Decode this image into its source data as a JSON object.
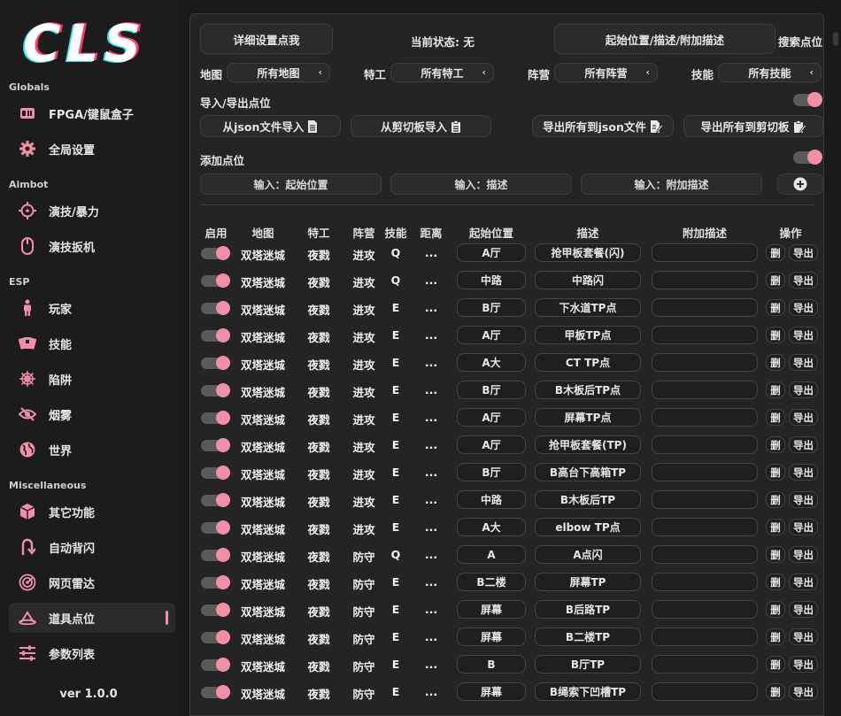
{
  "app": {
    "logo_text": "CLS",
    "version": "ver 1.0.0",
    "accent": "#f08fa5"
  },
  "sidebar": {
    "sections": [
      {
        "title": "Globals",
        "items": [
          {
            "label": "FPGA/键鼠盒子",
            "icon": "fpga-card-icon"
          },
          {
            "label": "全局设置",
            "icon": "gear-icon"
          }
        ]
      },
      {
        "title": "Aimbot",
        "items": [
          {
            "label": "演技/暴力",
            "icon": "crosshair-icon"
          },
          {
            "label": "演技扳机",
            "icon": "mouse-icon"
          }
        ]
      },
      {
        "title": "ESP",
        "items": [
          {
            "label": "玩家",
            "icon": "person-icon"
          },
          {
            "label": "技能",
            "icon": "cards-icon"
          },
          {
            "label": "陷阱",
            "icon": "spiderweb-icon"
          },
          {
            "label": "烟雾",
            "icon": "eye-slash-icon"
          },
          {
            "label": "世界",
            "icon": "globe-icon"
          }
        ]
      },
      {
        "title": "Miscellaneous",
        "items": [
          {
            "label": "其它功能",
            "icon": "cube-icon"
          },
          {
            "label": "自动背闪",
            "icon": "u-turn-icon"
          },
          {
            "label": "网页雷达",
            "icon": "radar-icon"
          },
          {
            "label": "道具点位",
            "icon": "location-icon",
            "active": true
          },
          {
            "label": "参数列表",
            "icon": "sliders-icon"
          }
        ]
      }
    ]
  },
  "toolbar": {
    "detail_button": "详细设置点我",
    "status_text": "当前状态: 无",
    "search_field_value": "起始位置/描述/附加描述",
    "search_label": "搜索点位"
  },
  "filters": [
    {
      "label": "地图",
      "value": "所有地图"
    },
    {
      "label": "特工",
      "value": "所有特工"
    },
    {
      "label": "阵营",
      "value": "所有阵营"
    },
    {
      "label": "技能",
      "value": "所有技能"
    }
  ],
  "import_export": {
    "title": "导入/导出点位",
    "toggle_on": true,
    "import_json": "从json文件导入",
    "import_clipboard": "从剪切板导入",
    "export_json": "导出所有到json文件",
    "export_clipboard": "导出所有到剪切板"
  },
  "add_point": {
    "title": "添加点位",
    "toggle_on": true,
    "start_placeholder": "输入：起始位置",
    "desc_placeholder": "输入：描述",
    "extra_placeholder": "输入：附加描述"
  },
  "table": {
    "headers": [
      "启用",
      "地图",
      "特工",
      "阵营",
      "技能",
      "距离",
      "起始位置",
      "描述",
      "附加描述",
      "操作"
    ],
    "delete_label": "删",
    "export_label": "导出",
    "rows": [
      {
        "enabled": true,
        "map": "双塔迷城",
        "agent": "夜戮",
        "side": "进攻",
        "skill": "Q",
        "dist": "...",
        "start": "A厅",
        "desc": "抢甲板套餐(闪)",
        "extra": ""
      },
      {
        "enabled": true,
        "map": "双塔迷城",
        "agent": "夜戮",
        "side": "进攻",
        "skill": "Q",
        "dist": "...",
        "start": "中路",
        "desc": "中路闪",
        "extra": ""
      },
      {
        "enabled": true,
        "map": "双塔迷城",
        "agent": "夜戮",
        "side": "进攻",
        "skill": "E",
        "dist": "...",
        "start": "B厅",
        "desc": "下水道TP点",
        "extra": ""
      },
      {
        "enabled": true,
        "map": "双塔迷城",
        "agent": "夜戮",
        "side": "进攻",
        "skill": "E",
        "dist": "...",
        "start": "A厅",
        "desc": "甲板TP点",
        "extra": ""
      },
      {
        "enabled": true,
        "map": "双塔迷城",
        "agent": "夜戮",
        "side": "进攻",
        "skill": "E",
        "dist": "...",
        "start": "A大",
        "desc": "CT TP点",
        "extra": ""
      },
      {
        "enabled": true,
        "map": "双塔迷城",
        "agent": "夜戮",
        "side": "进攻",
        "skill": "E",
        "dist": "...",
        "start": "B厅",
        "desc": "B木板后TP点",
        "extra": ""
      },
      {
        "enabled": true,
        "map": "双塔迷城",
        "agent": "夜戮",
        "side": "进攻",
        "skill": "E",
        "dist": "...",
        "start": "A厅",
        "desc": "屏幕TP点",
        "extra": ""
      },
      {
        "enabled": true,
        "map": "双塔迷城",
        "agent": "夜戮",
        "side": "进攻",
        "skill": "E",
        "dist": "...",
        "start": "A厅",
        "desc": "抢甲板套餐(TP)",
        "extra": ""
      },
      {
        "enabled": true,
        "map": "双塔迷城",
        "agent": "夜戮",
        "side": "进攻",
        "skill": "E",
        "dist": "...",
        "start": "B厅",
        "desc": "B高台下高箱TP",
        "extra": ""
      },
      {
        "enabled": true,
        "map": "双塔迷城",
        "agent": "夜戮",
        "side": "进攻",
        "skill": "E",
        "dist": "...",
        "start": "中路",
        "desc": "B木板后TP",
        "extra": ""
      },
      {
        "enabled": true,
        "map": "双塔迷城",
        "agent": "夜戮",
        "side": "进攻",
        "skill": "E",
        "dist": "...",
        "start": "A大",
        "desc": "elbow TP点",
        "extra": ""
      },
      {
        "enabled": true,
        "map": "双塔迷城",
        "agent": "夜戮",
        "side": "防守",
        "skill": "Q",
        "dist": "...",
        "start": "A",
        "desc": "A点闪",
        "extra": ""
      },
      {
        "enabled": true,
        "map": "双塔迷城",
        "agent": "夜戮",
        "side": "防守",
        "skill": "E",
        "dist": "...",
        "start": "B二楼",
        "desc": "屏幕TP",
        "extra": ""
      },
      {
        "enabled": true,
        "map": "双塔迷城",
        "agent": "夜戮",
        "side": "防守",
        "skill": "E",
        "dist": "...",
        "start": "屏幕",
        "desc": "B后路TP",
        "extra": ""
      },
      {
        "enabled": true,
        "map": "双塔迷城",
        "agent": "夜戮",
        "side": "防守",
        "skill": "E",
        "dist": "...",
        "start": "屏幕",
        "desc": "B二楼TP",
        "extra": ""
      },
      {
        "enabled": true,
        "map": "双塔迷城",
        "agent": "夜戮",
        "side": "防守",
        "skill": "E",
        "dist": "...",
        "start": "B",
        "desc": "B厅TP",
        "extra": ""
      },
      {
        "enabled": true,
        "map": "双塔迷城",
        "agent": "夜戮",
        "side": "防守",
        "skill": "E",
        "dist": "...",
        "start": "屏幕",
        "desc": "B绳索下凹槽TP",
        "extra": ""
      }
    ]
  }
}
